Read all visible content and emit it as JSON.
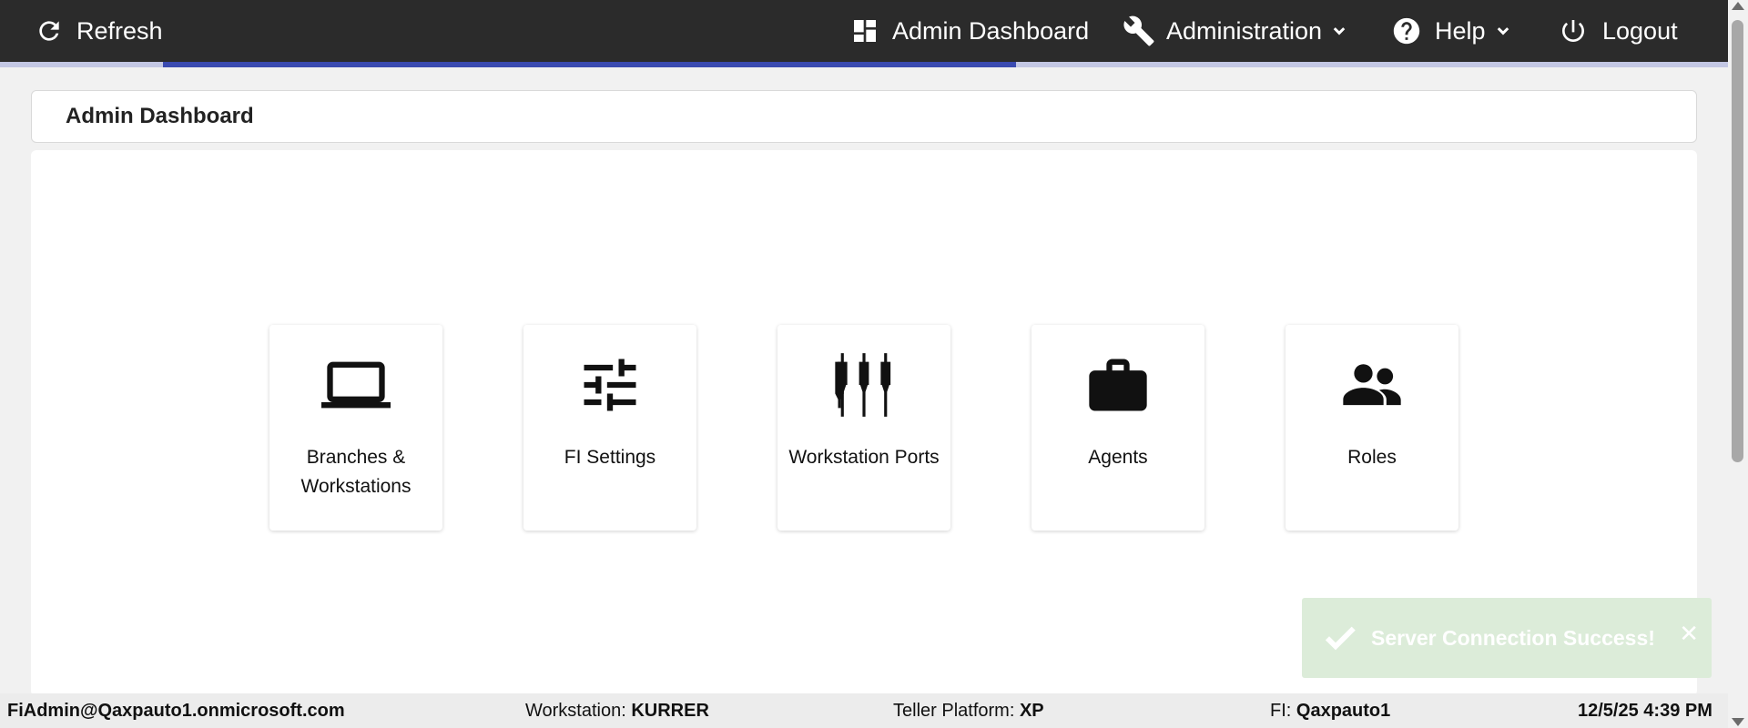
{
  "nav": {
    "refresh_label": "Refresh",
    "admin_dashboard_label": "Admin Dashboard",
    "administration_label": "Administration",
    "help_label": "Help",
    "logout_label": "Logout"
  },
  "progress": {
    "percent": 58
  },
  "page": {
    "title": "Admin Dashboard"
  },
  "tiles": [
    {
      "label": "Branches & Workstations",
      "icon": "laptop-icon"
    },
    {
      "label": "FI Settings",
      "icon": "sliders-icon"
    },
    {
      "label": "Workstation Ports",
      "icon": "ports-icon"
    },
    {
      "label": "Agents",
      "icon": "briefcase-icon"
    },
    {
      "label": "Roles",
      "icon": "people-icon"
    }
  ],
  "toast": {
    "message": "Server Connection Success!",
    "close": "✕"
  },
  "footer": {
    "user": "FiAdmin@Qaxpauto1.onmicrosoft.com",
    "workstation_label": "Workstation:",
    "workstation_value": "KURRER",
    "platform_label": "Teller Platform:",
    "platform_value": "XP",
    "fi_label": "FI:",
    "fi_value": "Qaxpauto1",
    "datetime": "12/5/25 4:39 PM"
  },
  "colors": {
    "topbar": "#2b2b2b",
    "progress_track": "#c3c7e3",
    "progress_fill": "#3a4ab0",
    "toast_bg": "#dcecd9"
  }
}
